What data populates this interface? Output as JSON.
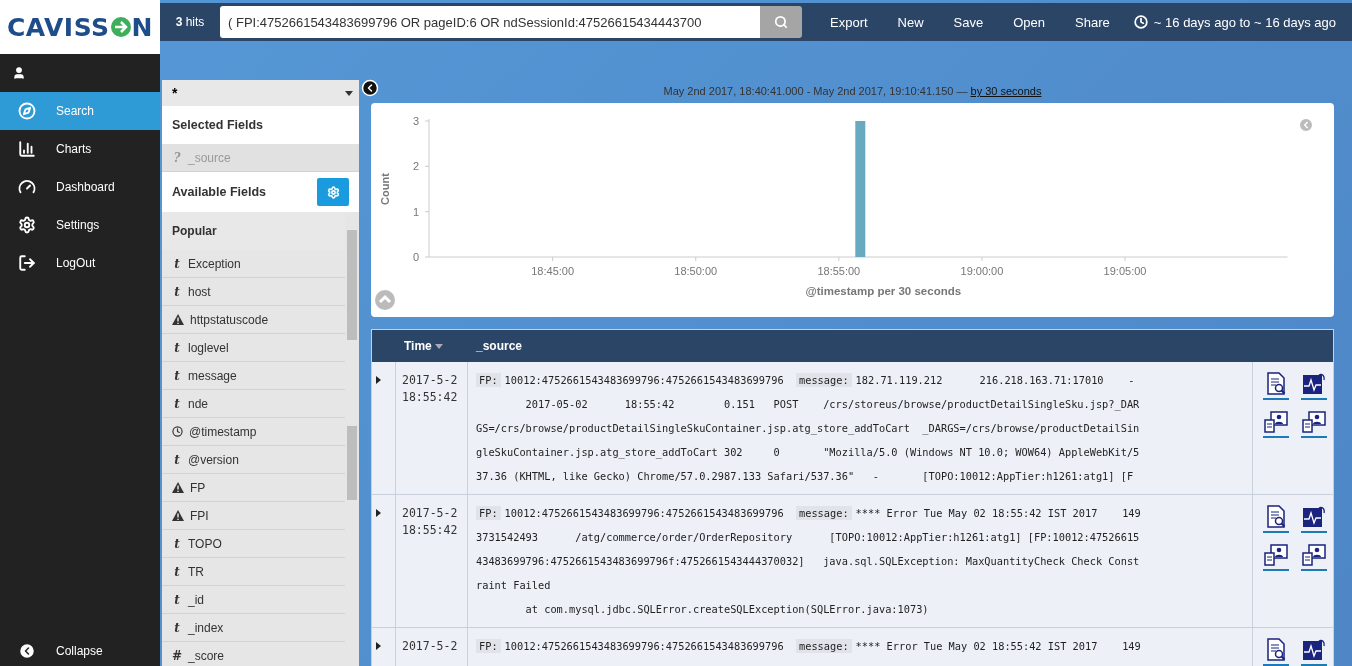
{
  "logo": {
    "text_before": "CAVISS",
    "text_after": "N"
  },
  "sidebar": {
    "items": [
      {
        "label": "Search",
        "selected": true
      },
      {
        "label": "Charts",
        "selected": false
      },
      {
        "label": "Dashboard",
        "selected": false
      },
      {
        "label": "Settings",
        "selected": false
      },
      {
        "label": "LogOut",
        "selected": false
      }
    ],
    "collapse": "Collapse"
  },
  "topbar": {
    "hits": "**3** hits",
    "query": "( FPI:4752661543483699796 OR pageID:6 OR ndSessionId:47526615434443700",
    "menu": [
      "Export",
      "New",
      "Save",
      "Open",
      "Share"
    ],
    "time_range": "~ 16 days ago to ~ 16 days ago"
  },
  "fields_panel": {
    "index": "*",
    "selected_title": "Selected Fields",
    "selected": [
      {
        "symbol": "?",
        "name": "_source"
      }
    ],
    "available_title": "Available Fields",
    "popular_title": "Popular",
    "fields": [
      {
        "kind": "text",
        "symbol": "t",
        "name": "Exception"
      },
      {
        "kind": "text",
        "symbol": "t",
        "name": "host"
      },
      {
        "kind": "warning",
        "name": "httpstatuscode"
      },
      {
        "kind": "text",
        "symbol": "t",
        "name": "loglevel"
      },
      {
        "kind": "text",
        "symbol": "t",
        "name": "message"
      },
      {
        "kind": "text",
        "symbol": "t",
        "name": "nde"
      },
      {
        "kind": "clock",
        "name": "@timestamp"
      },
      {
        "kind": "text",
        "symbol": "t",
        "name": "@version"
      },
      {
        "kind": "warning",
        "name": "FP"
      },
      {
        "kind": "warning",
        "name": "FPI"
      },
      {
        "kind": "text",
        "symbol": "t",
        "name": "TOPO"
      },
      {
        "kind": "text",
        "symbol": "t",
        "name": "TR"
      },
      {
        "kind": "text",
        "symbol": "t",
        "name": "_id"
      },
      {
        "kind": "text",
        "symbol": "t",
        "name": "_index"
      },
      {
        "kind": "text",
        "symbol": "#",
        "name": "_score"
      }
    ]
  },
  "range": {
    "text": "May 2nd 2017, 18:40:41.000 - May 2nd 2017, 19:10:41.150 —",
    "interval_link": "by 30 seconds"
  },
  "histogram": {
    "chart_data": {
      "type": "bar",
      "xlabel": "@timestamp per 30 seconds",
      "ylabel": "Count",
      "x": [
        1135.75
      ],
      "values": [
        3
      ],
      "xlim": [
        1120.68,
        1150.68
      ],
      "ylim": [
        0,
        3
      ],
      "xticks": [
        {
          "value": 1125,
          "label": "18:45:00"
        },
        {
          "value": 1130,
          "label": "18:50:00"
        },
        {
          "value": 1135,
          "label": "18:55:00"
        },
        {
          "value": 1140,
          "label": "19:00:00"
        },
        {
          "value": 1145,
          "label": "19:05:00"
        }
      ],
      "yticks": [
        0,
        1,
        2,
        3
      ]
    }
  },
  "table": {
    "columns": [
      {
        "label": "Time",
        "sorted": true
      },
      {
        "label": "_source",
        "sorted": false
      }
    ],
    "rows": [
      {
        "time": [
          "2017-5-2",
          "18:55:42"
        ],
        "fields": [
          {
            "label": "FP:",
            "value": "10012:4752661543483699796:4752661543483699796"
          },
          {
            "label": "message:",
            "value": "182.71.119.212      216.218.163.71:17010    -"
          }
        ],
        "lines": [
          "        2017-05-02      18:55:42        0.151   POST    /crs/storeus/browse/productDetailSingleSku.jsp?_DAR",
          "GS=/crs/browse/productDetailSingleSkuContainer.jsp.atg_store_addToCart  _DARGS=/crs/browse/productDetailSin",
          "gleSkuContainer.jsp.atg_store_addToCart 302     0       \"Mozilla/5.0 (Windows NT 10.0; WOW64) AppleWebKit/5",
          "37.36 (KHTML, like Gecko) Chrome/57.0.2987.133 Safari/537.36\"   -       [TOPO:10012:AppTier:h1261:atg1] [F"
        ]
      },
      {
        "time": [
          "2017-5-2",
          "18:55:42"
        ],
        "fields": [
          {
            "label": "FP:",
            "value": "10012:4752661543483699796:4752661543483699796"
          },
          {
            "label": "message:",
            "value": "**** Error Tue May 02 18:55:42 IST 2017    149"
          }
        ],
        "lines": [
          "3731542493      /atg/commerce/order/OrderRepository      [TOPO:10012:AppTier:h1261:atg1] [FP:10012:47526615",
          "43483699796:4752661543483699796f:4752661543444370032]   java.sql.SQLException: MaxQuantityCheck Check Const",
          "raint Failed",
          "        at com.mysql.jdbc.SQLError.createSQLException(SQLError.java:1073)"
        ]
      },
      {
        "time": [
          "2017-5-2"
        ],
        "fields": [
          {
            "label": "FP:",
            "value": "10012:4752661543483699796:4752661543483699796"
          },
          {
            "label": "message:",
            "value": "**** Error Tue May 02 18:55:42 IST 2017    149"
          }
        ],
        "lines": []
      }
    ]
  }
}
